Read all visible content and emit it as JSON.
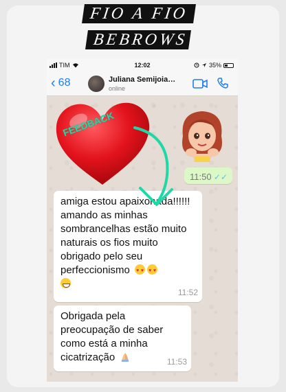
{
  "header": {
    "title_line_1": "FIO A FIO",
    "title_line_2": "BEBROWS"
  },
  "statusbar": {
    "carrier": "TIM",
    "time": "12:02",
    "battery": "35%"
  },
  "chat": {
    "back_count": "68",
    "contact_name": "Juliana Semijoia…",
    "contact_status": "online"
  },
  "annotation": {
    "label": "FEEDBACK",
    "heart_color": "#e3131c",
    "arrow_color": "#1ed9a7"
  },
  "messages": [
    {
      "direction": "outgoing",
      "time": "11:50",
      "ticks": "✓✓"
    },
    {
      "direction": "incoming",
      "text": "amiga estou apaixonada!!!!!! amando as minhas sombrancelhas estão muito naturais os fios muito obrigado pelo seu perfeccionismo",
      "time": "11:52"
    },
    {
      "direction": "incoming",
      "text": "Obrigada pela preocupação de saber como está a minha cicatrização",
      "time": "11:53"
    }
  ],
  "colors": {
    "ios_blue": "#1f7cf0",
    "wa_bg": "#e5ddd5",
    "out_bubble": "#dcf8c6",
    "read_ticks": "#4fc3f7"
  }
}
